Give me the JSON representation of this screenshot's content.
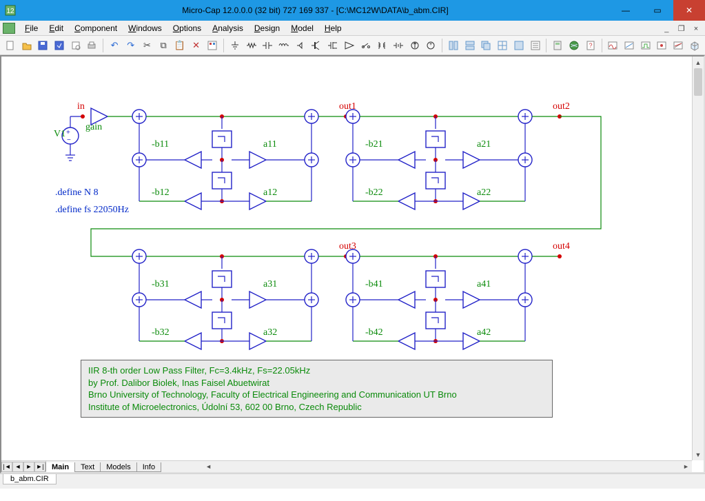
{
  "window": {
    "title": "Micro-Cap 12.0.0.0 (32 bit) 727 169 337 - [C:\\MC12W\\DATA\\b_abm.CIR]"
  },
  "menu": {
    "file": "File",
    "edit": "Edit",
    "component": "Component",
    "windows": "Windows",
    "options": "Options",
    "analysis": "Analysis",
    "design": "Design",
    "model": "Model",
    "help": "Help"
  },
  "sheet_tabs": {
    "main": "Main",
    "text": "Text",
    "models": "Models",
    "info": "Info"
  },
  "status": {
    "file_tab": "b_abm.CIR"
  },
  "schematic": {
    "in": "in",
    "out1": "out1",
    "out2": "out2",
    "out3": "out3",
    "out4": "out4",
    "v1": "V1",
    "gain": "gain",
    "b11": "-b11",
    "a11": "a11",
    "b12": "-b12",
    "a12": "a12",
    "b21": "-b21",
    "a21": "a21",
    "b22": "-b22",
    "a22": "a22",
    "b31": "-b31",
    "a31": "a31",
    "b32": "-b32",
    "a32": "a32",
    "b41": "-b41",
    "a41": "a41",
    "b42": "-b42",
    "a42": "a42",
    "def_n": ".define N 8",
    "def_fs": ".define fs 22050Hz"
  },
  "infobox": {
    "l1": "IIR 8-th order Low Pass Filter, Fc=3.4kHz, Fs=22.05kHz",
    "l2": "by Prof. Dalibor Biolek, Inas Faisel Abuetwirat",
    "l3": "Brno University of Technology, Faculty of Electrical Engineering and Communication UT Brno",
    "l4": "Institute of Microelectronics, Údolní 53, 602 00 Brno, Czech Republic"
  }
}
